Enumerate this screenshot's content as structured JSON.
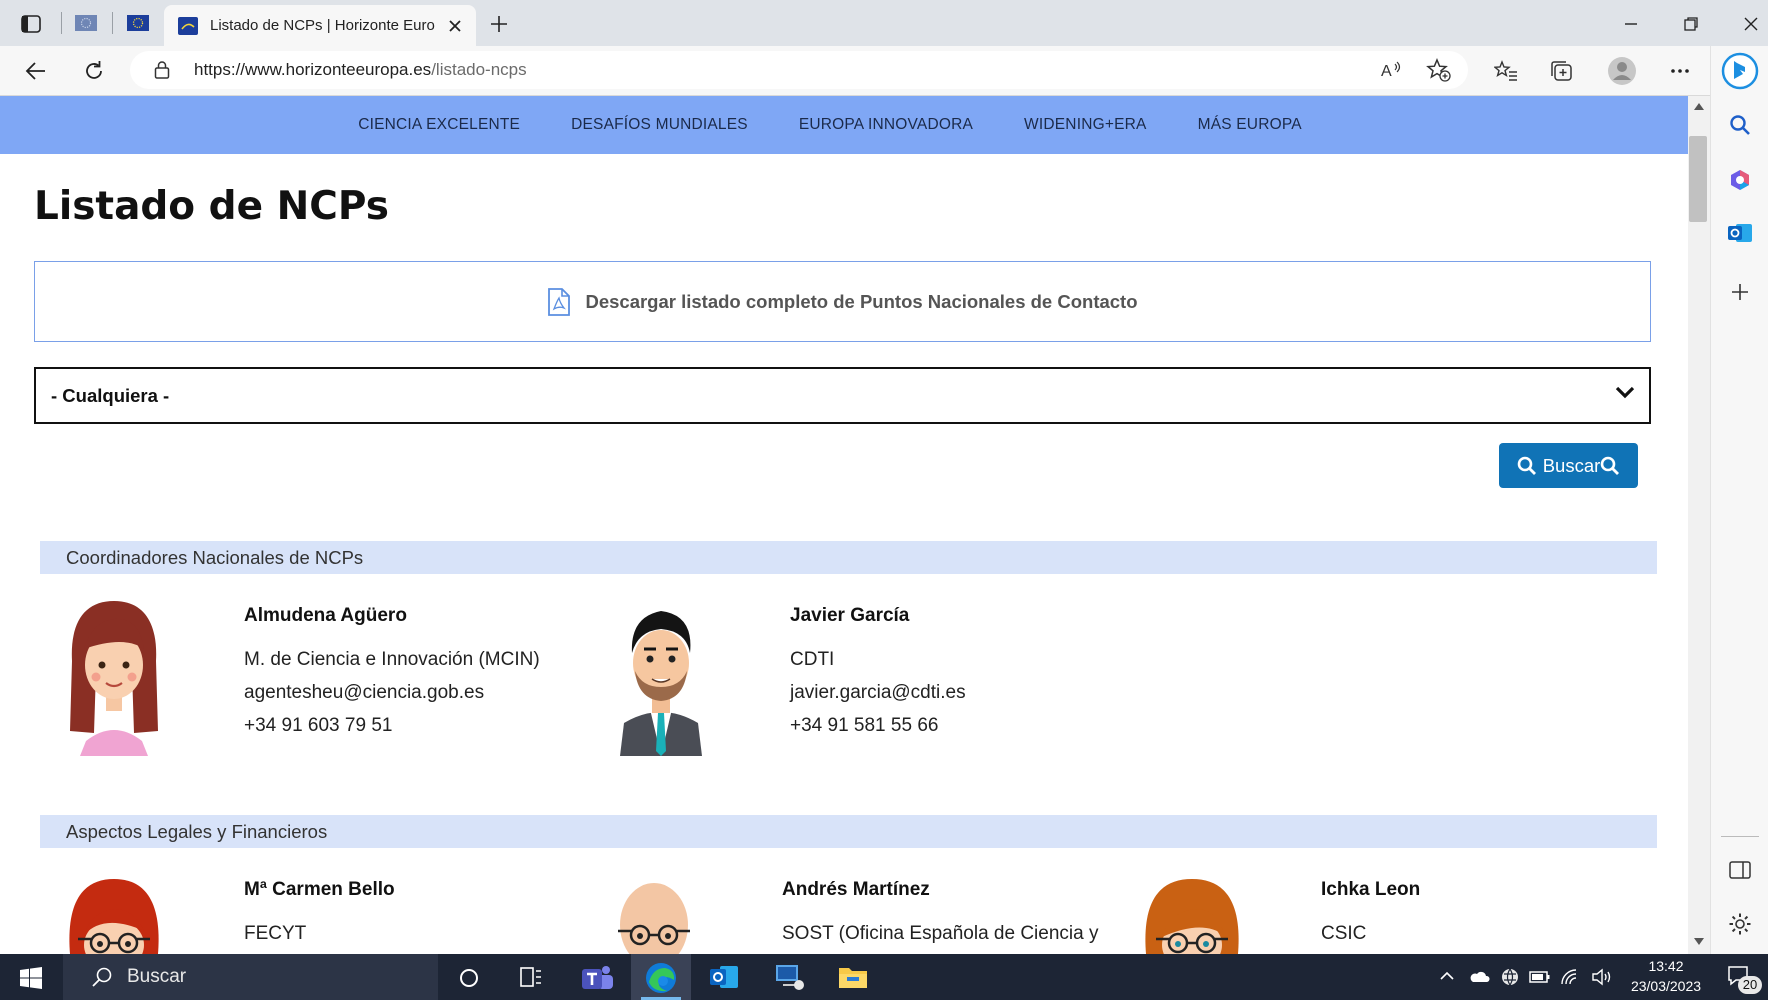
{
  "browser": {
    "active_tab_title": "Listado de NCPs | Horizonte Euro",
    "url_host": "https://www.horizonteeuropa.es",
    "url_path": "/listado-ncps"
  },
  "nav": {
    "items": [
      "CIENCIA EXCELENTE",
      "DESAFÍOS MUNDIALES",
      "EUROPA INNOVADORA",
      "WIDENING+ERA",
      "MÁS EUROPA"
    ]
  },
  "page": {
    "title": "Listado de NCPs",
    "download_label": "Descargar listado completo de Puntos Nacionales de Contacto",
    "select_value": "- Cualquiera -",
    "search_label": "Buscar"
  },
  "sections": [
    {
      "title": "Coordinadores Nacionales de NCPs",
      "contacts": [
        {
          "name": "Almudena Agüero",
          "org": "M. de Ciencia e Innovación (MCIN)",
          "email": "agentesheu@ciencia.gob.es",
          "phone": "+34 91 603 79 51",
          "avatar": "woman-brown-hair-avatar"
        },
        {
          "name": "Javier García",
          "org": "CDTI",
          "email": "javier.garcia@cdti.es",
          "phone": "+34 91 581 55 66",
          "avatar": "man-beard-suit-avatar"
        }
      ]
    },
    {
      "title": "Aspectos Legales y Financieros",
      "contacts": [
        {
          "name": "Mª Carmen Bello",
          "org": "FECYT",
          "avatar": "woman-red-hair-glasses-avatar"
        },
        {
          "name": "Andrés Martínez",
          "org": "SOST (Oficina Española de Ciencia y",
          "avatar": "bald-man-glasses-avatar"
        },
        {
          "name": "Ichka Leon",
          "org": "CSIC",
          "avatar": "woman-auburn-hair-glasses-avatar"
        }
      ]
    }
  ],
  "taskbar": {
    "search_placeholder": "Buscar",
    "time": "13:42",
    "date": "23/03/2023",
    "notification_count": "20"
  },
  "colors": {
    "nav_bg": "#7fa7f5",
    "section_bg": "#d8e3f9",
    "button_bg": "#1073b6"
  }
}
